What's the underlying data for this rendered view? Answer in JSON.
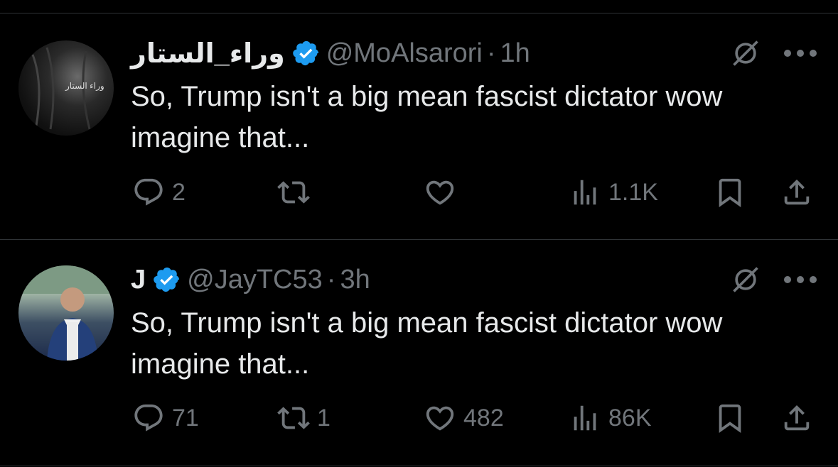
{
  "tweets": [
    {
      "name": "وراء_الستار",
      "avatar_text": "وراء الستار",
      "handle": "@MoAlsarori",
      "separator": "·",
      "time": "1h",
      "text": "So, Trump isn't a big mean fascist dictator wow imagine that...",
      "replies": "2",
      "reposts": "",
      "likes": "",
      "views": "1.1K"
    },
    {
      "name": "J",
      "handle": "@JayTC53",
      "separator": "·",
      "time": "3h",
      "text": "So, Trump isn't a big mean fascist dictator wow imagine that...",
      "replies": "71",
      "reposts": "1",
      "likes": "482",
      "views": "86K"
    }
  ],
  "colors": {
    "background": "#000000",
    "text": "#e7e9ea",
    "muted": "#71767b",
    "verified": "#1d9bf0",
    "divider": "#2f3336"
  },
  "icons": [
    "verified-badge-icon",
    "grok-icon",
    "more-icon",
    "reply-icon",
    "repost-icon",
    "like-icon",
    "views-icon",
    "bookmark-icon",
    "share-icon"
  ]
}
